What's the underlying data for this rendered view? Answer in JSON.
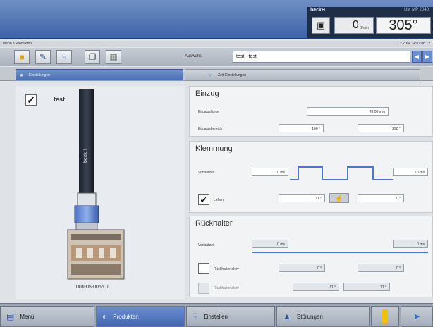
{
  "header": {
    "brand": "beckH",
    "cap_text": "UM MP 2040",
    "camera_icon": "camera-icon",
    "speed_value": "0",
    "speed_unit": "1/min",
    "angle_value": "305°"
  },
  "path": {
    "text": "Menü > Produkten",
    "date": "2.2004 14:07:06 12"
  },
  "toolbar": {
    "program_label": "Auswahl:",
    "program_value": "test - test",
    "icons": [
      "folder-icon",
      "pen-icon",
      "hand-icon",
      "copy-icon",
      "grid-icon"
    ]
  },
  "tabs": [
    {
      "label": "Einstellungen"
    },
    {
      "label": "Zeit-Einstellungen"
    }
  ],
  "left": {
    "checked": "✓",
    "tool_name": "test",
    "tool_id": "000-05-0066.0"
  },
  "einzug": {
    "title": "Einzug",
    "row1_label": "Einzugslänge",
    "row1_value": "28.00 mm",
    "row2_label": "Einzugsbereich",
    "row2_value_a": "100 °",
    "row2_value_b": "290 °"
  },
  "klemmung": {
    "title": "Klemmung",
    "row1_label": "Vorlaufzeit",
    "row1_value_a": "10 ms",
    "row1_value_b": "10 ms",
    "checked": "✓",
    "row2_label": "Lüften",
    "row2_value_a": "11 °",
    "row2_value_b": "0 °"
  },
  "rueckhalter": {
    "title": "Rückhalter",
    "row1_label": "Vorlaufzeit",
    "row1_value_a": "0 ms",
    "row1_value_b": "0 ms",
    "row2_label": "Rückhalter aktiv",
    "row2_value_a": "0 °",
    "row2_value_b": "0 °",
    "row3_label": "Rückhalter aktiv",
    "row3_value_a": "11 °",
    "row3_value_b": "11 °"
  },
  "bottom": {
    "menu": "Menü",
    "produkten": "Produkten",
    "einstellen": "Einstellen",
    "stoerungen": "Störungen"
  }
}
